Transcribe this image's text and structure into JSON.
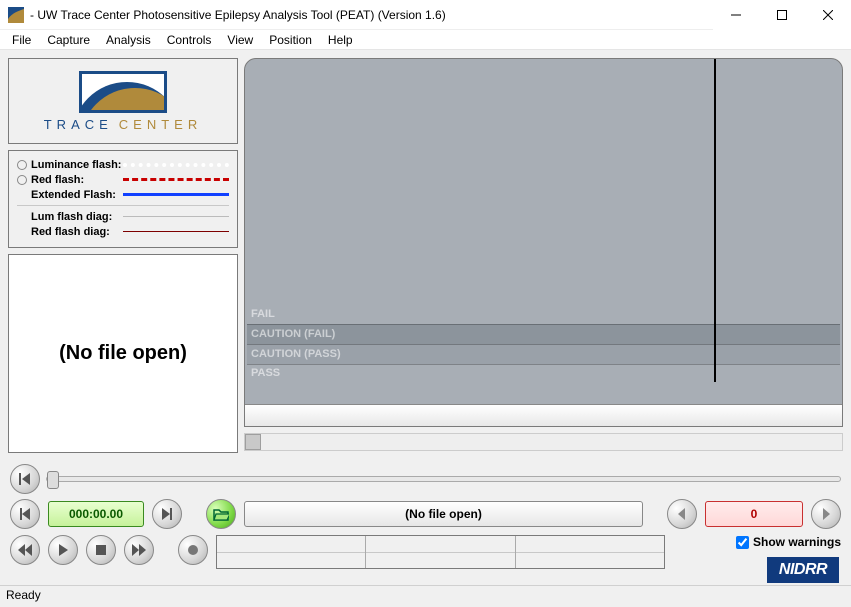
{
  "titlebar": {
    "title": "- UW Trace Center Photosensitive Epilepsy Analysis Tool (PEAT) (Version 1.6)"
  },
  "menu": {
    "items": [
      "File",
      "Capture",
      "Analysis",
      "Controls",
      "View",
      "Position",
      "Help"
    ]
  },
  "logo": {
    "part1": "TRACE",
    "part2": "CENTER"
  },
  "legend": {
    "luminance": "Luminance flash:",
    "red": "Red flash:",
    "extended": "Extended Flash:",
    "lumdiag": "Lum flash diag:",
    "reddiag": "Red flash diag:"
  },
  "preview": {
    "label": "(No file open)"
  },
  "zones": {
    "fail": "FAIL",
    "cfail": "CAUTION (FAIL)",
    "cpass": "CAUTION (PASS)",
    "pass": "PASS"
  },
  "timecode": "000:00.00",
  "filebox": "(No file open)",
  "warning_count": "0",
  "show_warnings_label": "Show warnings",
  "show_warnings_checked": true,
  "nidrr": "NIDRR",
  "status": "Ready"
}
